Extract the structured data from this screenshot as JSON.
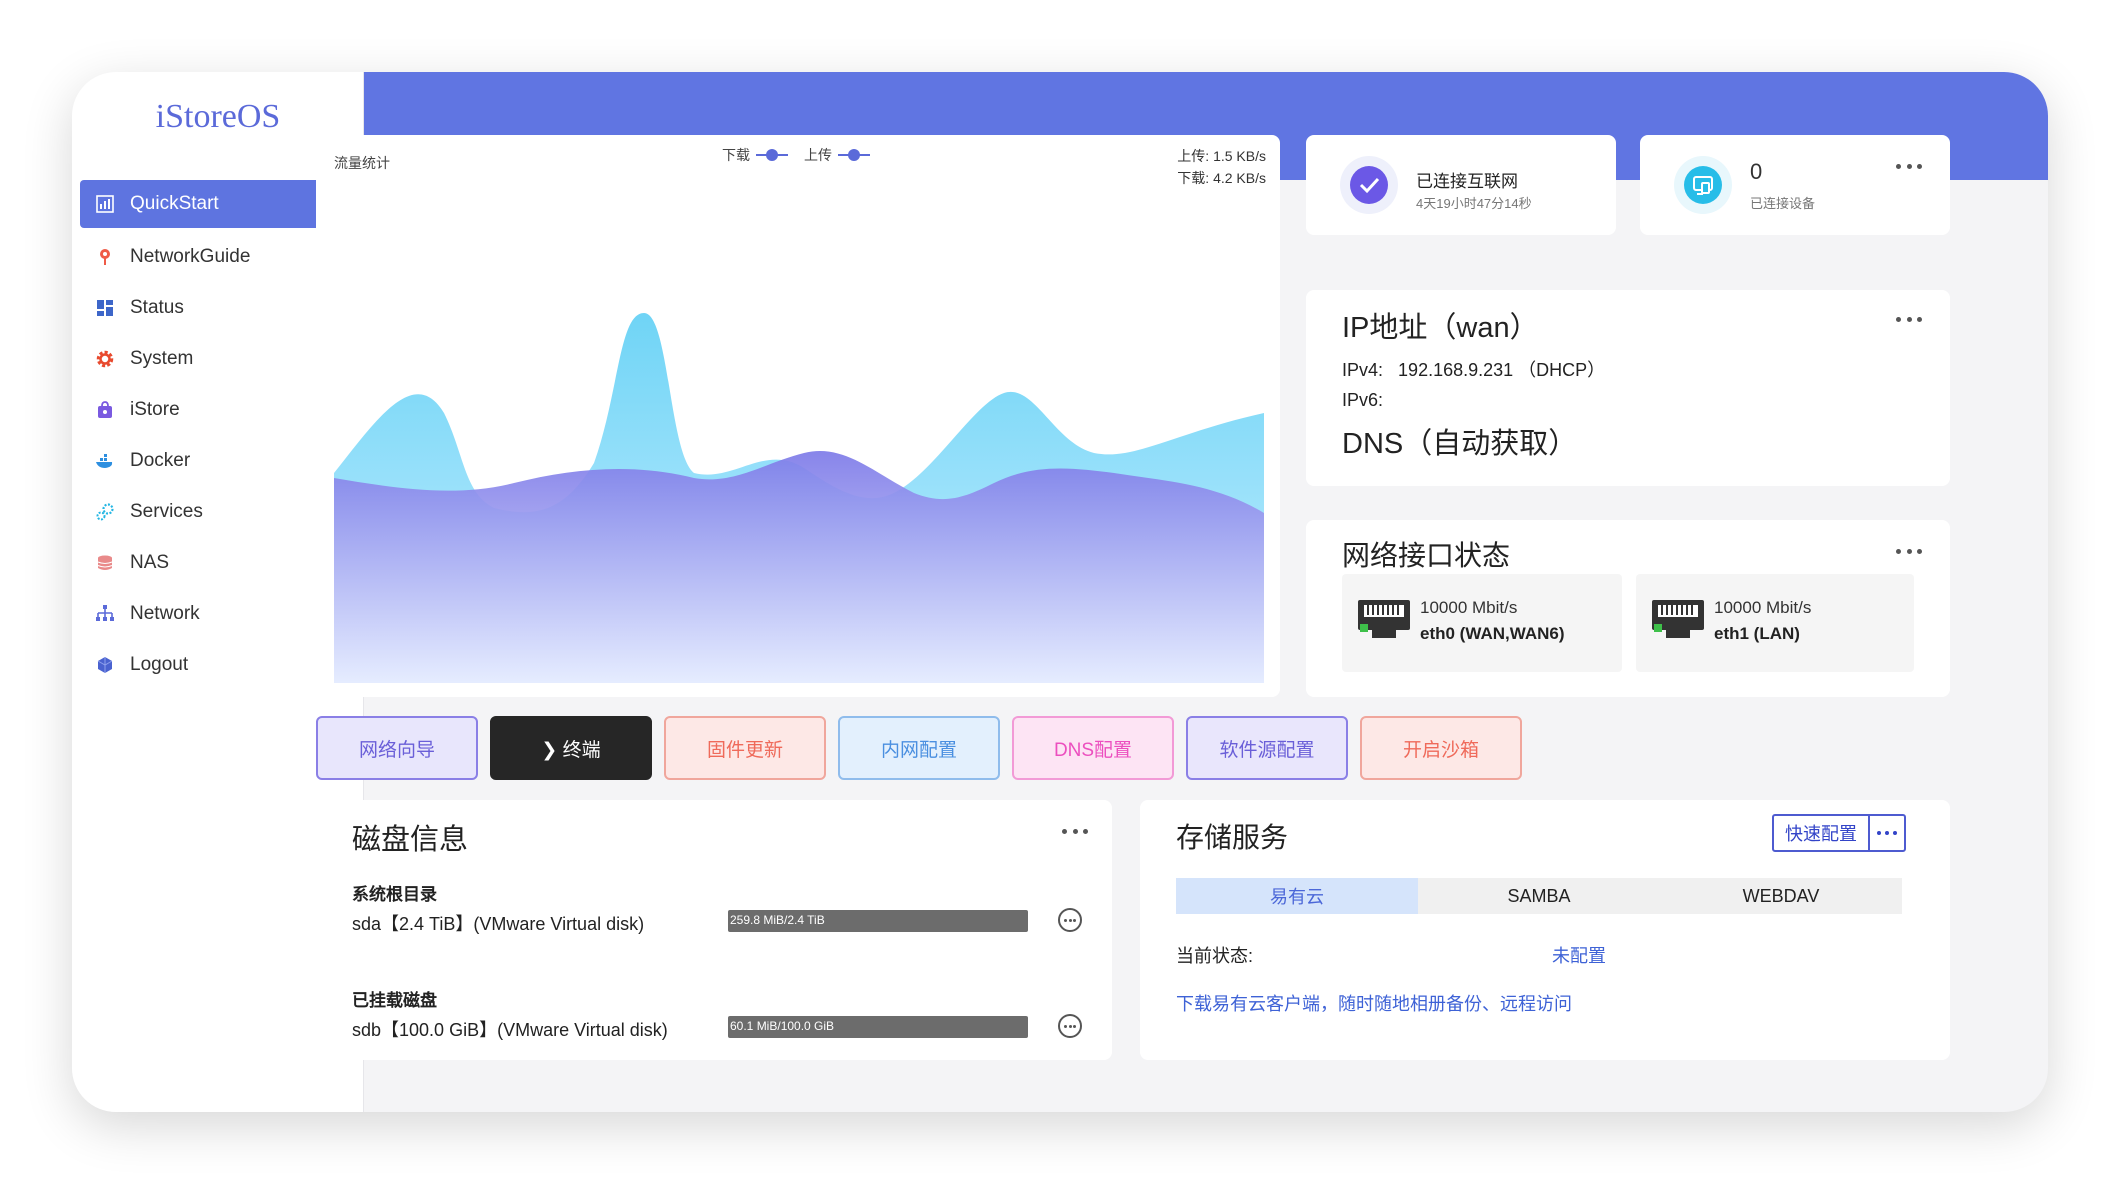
{
  "brand": "iStoreOS",
  "menu": [
    {
      "label": "QuickStart",
      "icon": "dashboard-icon",
      "active": true
    },
    {
      "label": "NetworkGuide",
      "icon": "network-guide-icon"
    },
    {
      "label": "Status",
      "icon": "status-icon",
      "expandable": true
    },
    {
      "label": "System",
      "icon": "gear-icon",
      "expandable": true
    },
    {
      "label": "iStore",
      "icon": "store-icon"
    },
    {
      "label": "Docker",
      "icon": "docker-icon",
      "expandable": true
    },
    {
      "label": "Services",
      "icon": "services-icon",
      "expandable": true
    },
    {
      "label": "NAS",
      "icon": "nas-icon",
      "expandable": true
    },
    {
      "label": "Network",
      "icon": "network-icon",
      "expandable": true
    },
    {
      "label": "Logout",
      "icon": "logout-icon"
    }
  ],
  "traffic": {
    "title": "流量统计",
    "legend_download": "下载",
    "legend_upload": "上传",
    "upload_rate": "上传: 1.5 KB/s",
    "download_rate": "下载: 4.2 KB/s"
  },
  "connection": {
    "status": "已连接互联网",
    "uptime": "4天19小时47分14秒"
  },
  "devices": {
    "count": "0",
    "label": "已连接设备"
  },
  "ip": {
    "title": "IP地址（wan）",
    "ipv4_label": "IPv4:",
    "ipv4_value": "192.168.9.231 （DHCP）",
    "ipv6_label": "IPv6:",
    "dns": "DNS（自动获取）"
  },
  "interfaces": {
    "title": "网络接口状态",
    "ports": [
      {
        "speed": "10000 Mbit/s",
        "name": "eth0 (WAN,WAN6)"
      },
      {
        "speed": "10000 Mbit/s",
        "name": "eth1 (LAN)"
      }
    ]
  },
  "actions": [
    {
      "label": "网络向导",
      "bg": "#e8e6fc",
      "border": "#8a7fe6",
      "color": "#6a5fd8"
    },
    {
      "label": "❯ 终端",
      "bg": "#262626",
      "border": "#262626",
      "color": "#ffffff"
    },
    {
      "label": "固件更新",
      "bg": "#fde8e6",
      "border": "#f0a69c",
      "color": "#ef6a5a"
    },
    {
      "label": "内网配置",
      "bg": "#e3f0fd",
      "border": "#8fbcec",
      "color": "#4a8fe0"
    },
    {
      "label": "DNS配置",
      "bg": "#fde4f4",
      "border": "#f29ad6",
      "color": "#ec4fbf"
    },
    {
      "label": "软件源配置",
      "bg": "#e9e6fc",
      "border": "#8a7fe6",
      "color": "#6a5fd8"
    },
    {
      "label": "开启沙箱",
      "bg": "#fde8e6",
      "border": "#f0a69c",
      "color": "#ef6a5a"
    }
  ],
  "disk": {
    "title": "磁盘信息",
    "system_root": "系统根目录",
    "sda": "sda【2.4 TiB】(VMware Virtual disk)",
    "sda_usage": "259.8 MiB/2.4 TiB",
    "mounted": "已挂载磁盘",
    "sdb": "sdb【100.0 GiB】(VMware Virtual disk)",
    "sdb_usage": "60.1 MiB/100.0 GiB"
  },
  "storage": {
    "title": "存储服务",
    "quick_config": "快速配置",
    "tabs": [
      "易有云",
      "SAMBA",
      "WEBDAV"
    ],
    "status_label": "当前状态:",
    "status_value": "未配置",
    "download_link": "下载易有云客户端，随时随地相册备份、远程访问"
  }
}
